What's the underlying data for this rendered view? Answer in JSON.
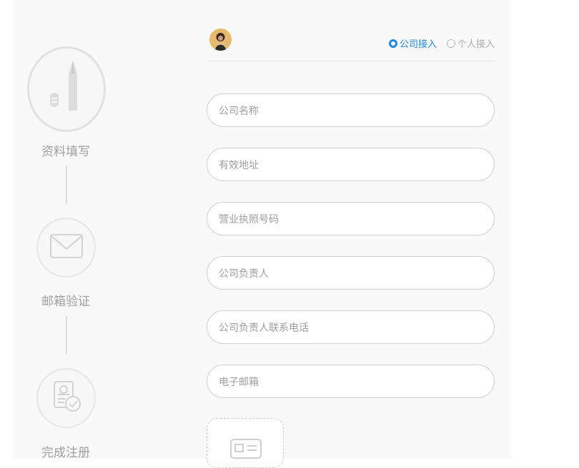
{
  "steps": [
    {
      "label": "资料填写",
      "icon": "pen-icon"
    },
    {
      "label": "邮箱验证",
      "icon": "envelope-icon"
    },
    {
      "label": "完成注册",
      "icon": "id-card-check-icon"
    }
  ],
  "header": {
    "avatar": "user-avatar",
    "access_type": {
      "options": [
        "公司接入",
        "个人接入"
      ],
      "selected": "公司接入"
    }
  },
  "form": {
    "fields": [
      {
        "placeholder": "公司名称",
        "value": ""
      },
      {
        "placeholder": "有效地址",
        "value": ""
      },
      {
        "placeholder": "营业执照号码",
        "value": ""
      },
      {
        "placeholder": "公司负责人",
        "value": ""
      },
      {
        "placeholder": "公司负责人联系电话",
        "value": ""
      },
      {
        "placeholder": "电子邮箱",
        "value": ""
      }
    ],
    "upload_icon": "id-card-icon"
  },
  "colors": {
    "accent": "#1e88e5",
    "panel_bg": "#f9f9f9",
    "muted_text": "#9f9f9f",
    "border": "#cfcfcf"
  }
}
